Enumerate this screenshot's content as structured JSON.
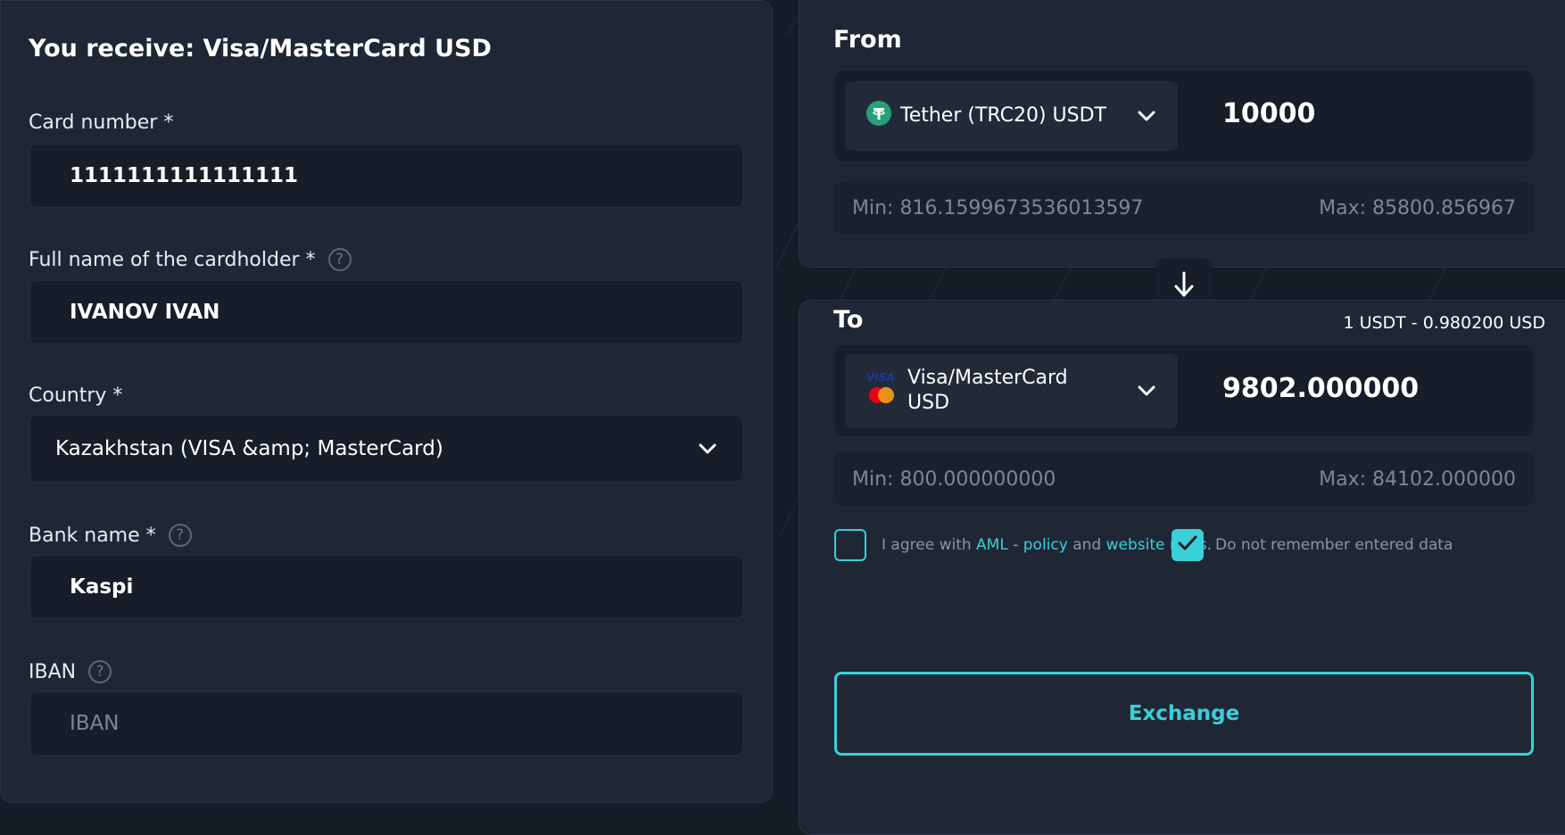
{
  "left": {
    "title": "You receive: Visa/MasterCard USD",
    "card_number": {
      "label": "Card number *",
      "value": "1111111111111111"
    },
    "cardholder": {
      "label": "Full name of the cardholder *",
      "value": "IVANOV IVAN"
    },
    "country": {
      "label": "Country *",
      "value": "Kazakhstan (VISA &amp; MasterCard)"
    },
    "bank": {
      "label": "Bank name *",
      "value": "Kaspi"
    },
    "iban": {
      "label": "IBAN",
      "placeholder": "IBAN"
    },
    "help_glyph": "?"
  },
  "from": {
    "title": "From",
    "currency": "Tether (TRC20) USDT",
    "currency_icon": "tether-icon",
    "amount": "10000",
    "min": "Min: 816.1599673536013597",
    "max": "Max: 85800.856967"
  },
  "to": {
    "title": "To",
    "rate": "1 USDT - 0.980200 USD",
    "currency_line1": "Visa/MasterCard",
    "currency_line2": "USD",
    "currency_icon": "visa-mastercard-icon",
    "amount": "9802.000000",
    "min": "Min: 800.000000000",
    "max": "Max: 84102.000000"
  },
  "agreement": {
    "prefix": "I agree with ",
    "aml_link": "AML - policy",
    "middle": " and ",
    "rules_link": "website rules.",
    "checked": false
  },
  "remember": {
    "label": "Do not remember entered data",
    "checked": true
  },
  "exchange_button": "Exchange",
  "colors": {
    "accent": "#39d0d8",
    "panel": "#1f2735",
    "field": "#171e29",
    "background": "#161c26",
    "tether": "#26a17b"
  }
}
